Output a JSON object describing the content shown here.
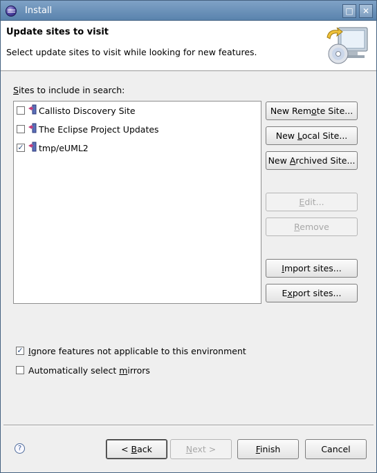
{
  "window": {
    "title": "Install",
    "minimize_glyph": "□",
    "close_glyph": "✕"
  },
  "header": {
    "title": "Update sites to visit",
    "description": "Select update sites to visit while looking for new features."
  },
  "sites": {
    "label_mnemonic": "S",
    "label_rest": "ites to include in search:",
    "items": [
      {
        "label": "Callisto Discovery Site",
        "checked": false,
        "check_glyph": ""
      },
      {
        "label": "The Eclipse Project Updates",
        "checked": false,
        "check_glyph": ""
      },
      {
        "label": "tmp/eUML2",
        "checked": true,
        "check_glyph": "✓"
      }
    ]
  },
  "buttons": {
    "new_remote": {
      "pre": "New Rem",
      "mn": "o",
      "post": "te Site..."
    },
    "new_local": {
      "pre": "New ",
      "mn": "L",
      "post": "ocal Site..."
    },
    "new_archived": {
      "pre": "New ",
      "mn": "A",
      "post": "rchived Site..."
    },
    "edit": {
      "pre": "",
      "mn": "E",
      "post": "dit..."
    },
    "remove": {
      "pre": "",
      "mn": "R",
      "post": "emove"
    },
    "import": {
      "pre": "",
      "mn": "I",
      "post": "mport sites..."
    },
    "export": {
      "pre": "E",
      "mn": "x",
      "post": "port sites..."
    }
  },
  "options": {
    "ignore": {
      "pre": "",
      "mn": "I",
      "post": "gnore features not applicable to this environment",
      "checked": true,
      "check_glyph": "✓"
    },
    "mirrors": {
      "pre": "Automatically select ",
      "mn": "m",
      "post": "irrors",
      "checked": false,
      "check_glyph": ""
    }
  },
  "footer": {
    "help_glyph": "?",
    "back": {
      "pre": "< ",
      "mn": "B",
      "post": "ack"
    },
    "next": {
      "pre": "",
      "mn": "N",
      "post": "ext >"
    },
    "finish": {
      "pre": "",
      "mn": "F",
      "post": "inish"
    },
    "cancel": {
      "label": "Cancel"
    }
  },
  "colors": {
    "titlebar": "#5a83ad",
    "disabled_text": "#a8a8a8"
  }
}
